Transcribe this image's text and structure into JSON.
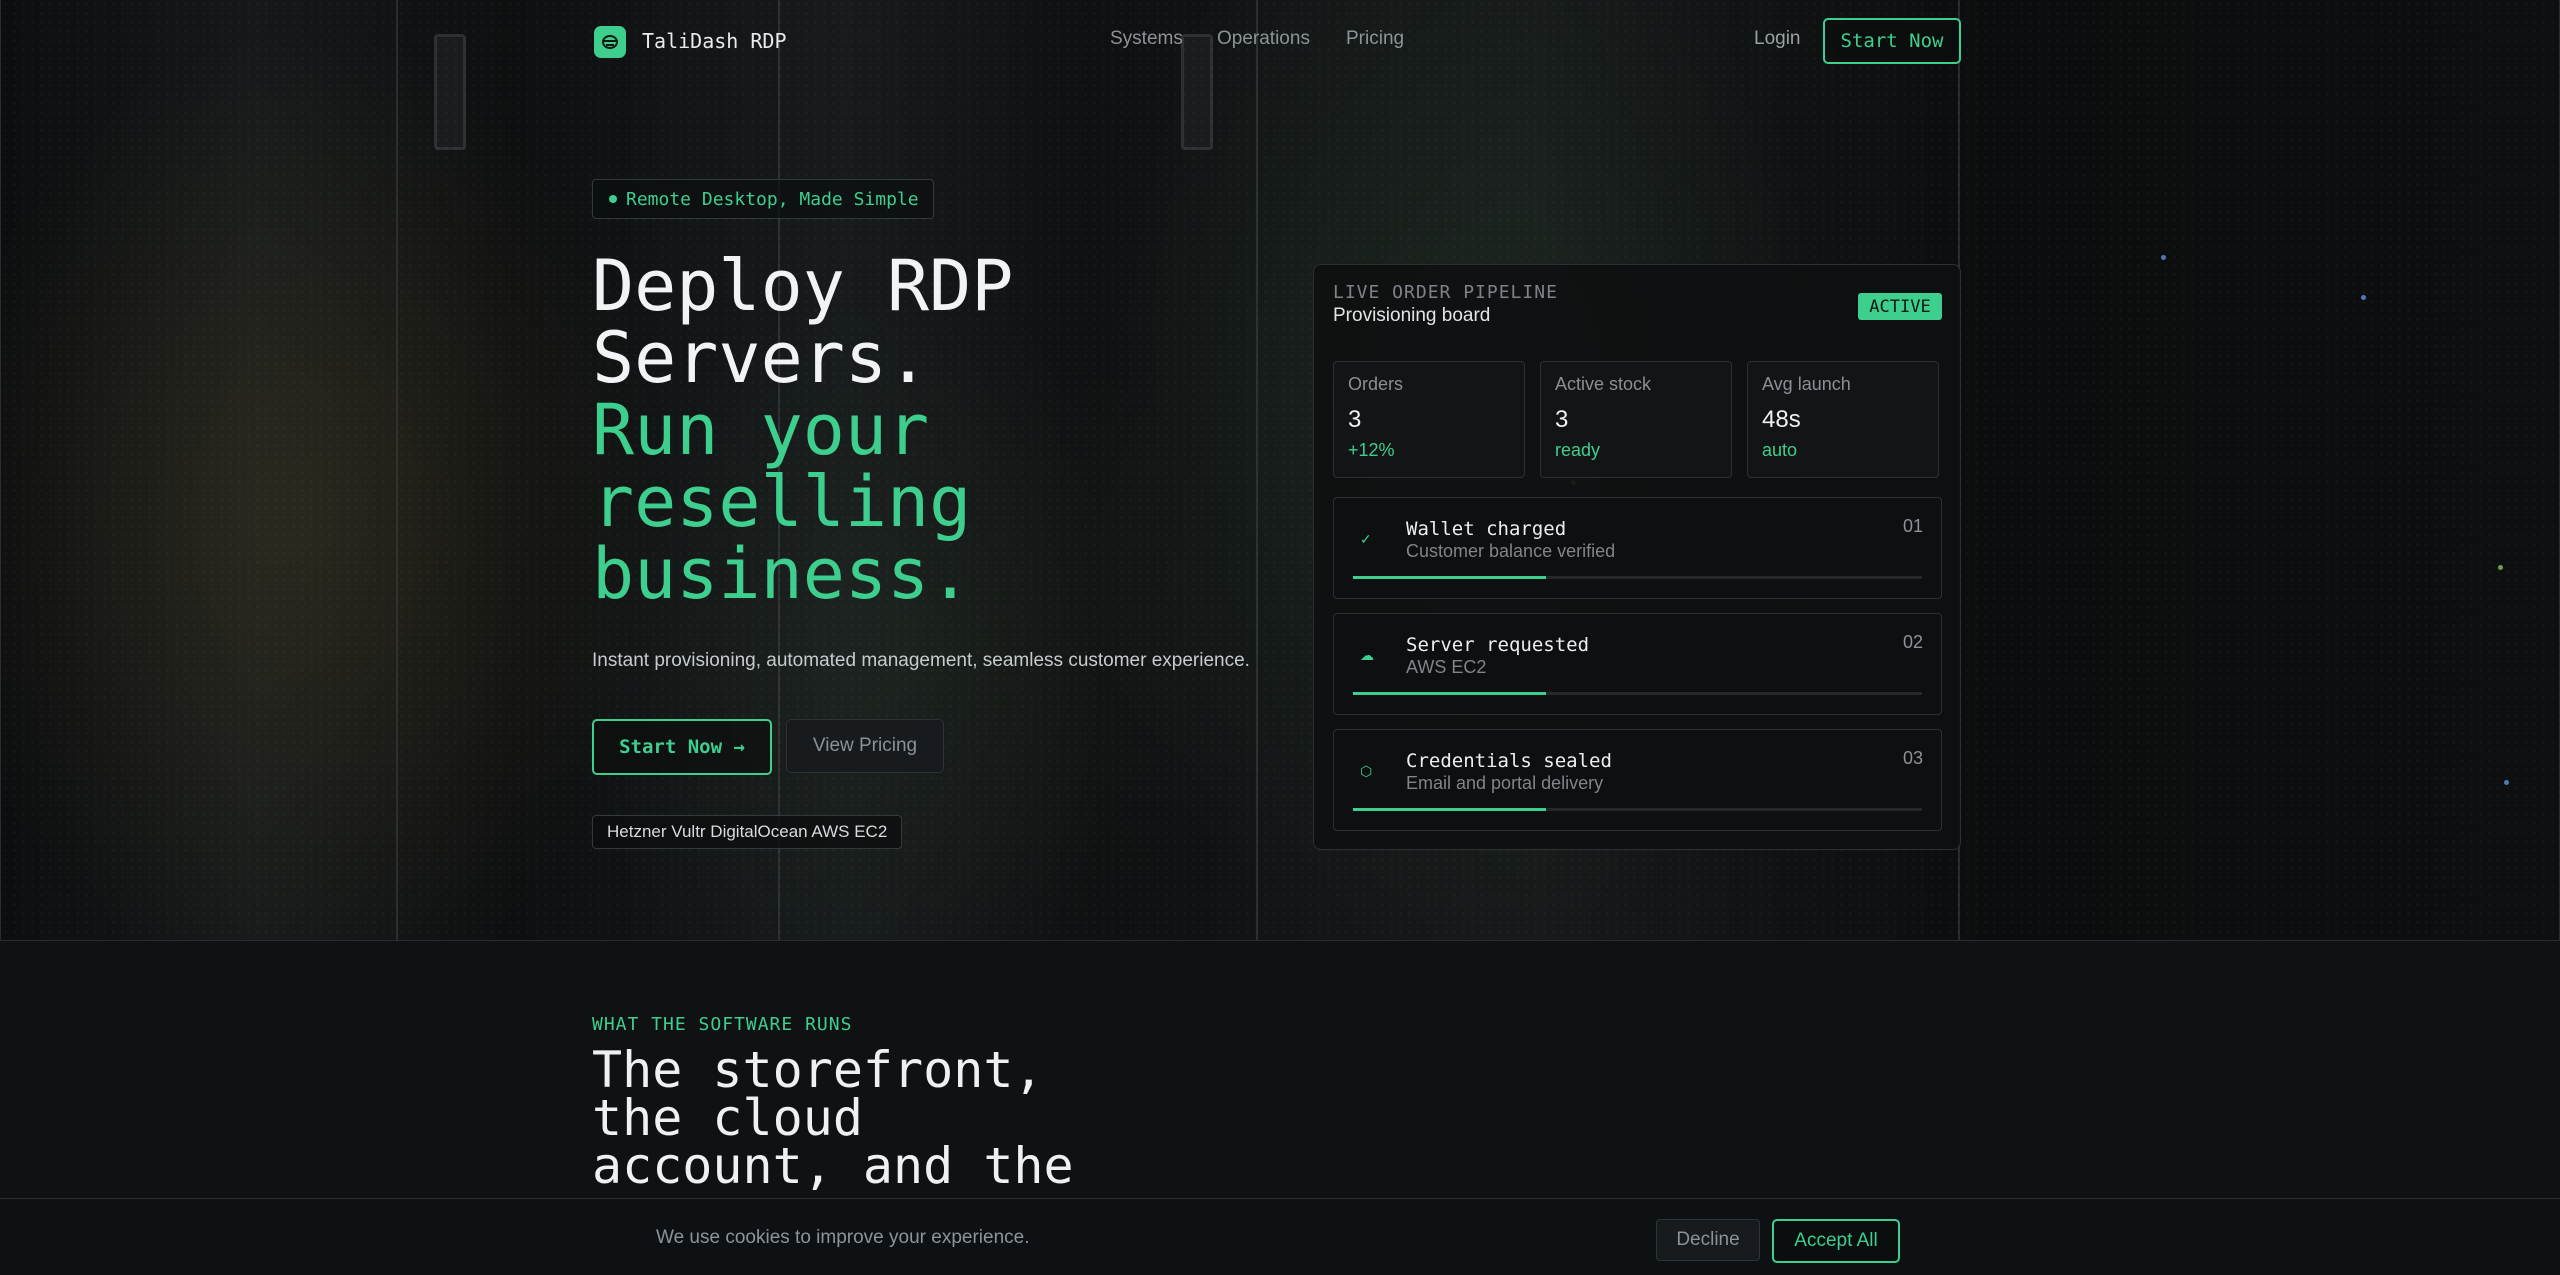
{
  "nav": {
    "brand": "TaliDash RDP",
    "links": [
      "Systems",
      "Operations",
      "Pricing"
    ],
    "login": "Login",
    "cta": "Start Now"
  },
  "hero": {
    "badge": "Remote Desktop, Made Simple",
    "headline_white": [
      "Deploy RDP",
      "Servers."
    ],
    "headline_green": [
      "Run your",
      "reselling",
      "business."
    ],
    "subtitle": "Instant provisioning, automated management, seamless customer experience.",
    "primary_cta": "Start Now →",
    "secondary_cta": "View Pricing",
    "providers": "Hetzner Vultr DigitalOcean AWS EC2"
  },
  "pipeline": {
    "label": "LIVE ORDER PIPELINE",
    "title": "Provisioning board",
    "status": "ACTIVE",
    "stats": [
      {
        "label": "Orders",
        "value": "3",
        "delta": "+12%"
      },
      {
        "label": "Active stock",
        "value": "3",
        "delta": "ready"
      },
      {
        "label": "Avg launch",
        "value": "48s",
        "delta": "auto"
      }
    ],
    "steps": [
      {
        "icon": "check-icon",
        "title": "Wallet charged",
        "desc": "Customer balance verified",
        "num": "01",
        "progress": 0.34
      },
      {
        "icon": "cloud-icon",
        "title": "Server requested",
        "desc": "AWS EC2",
        "num": "02",
        "progress": 0.34
      },
      {
        "icon": "hexagon-icon",
        "title": "Credentials sealed",
        "desc": "Email and portal delivery",
        "num": "03",
        "progress": 0.34
      }
    ]
  },
  "section": {
    "eyebrow": "WHAT THE SOFTWARE RUNS",
    "title_lines": [
      "The storefront,",
      "the cloud",
      "account, and the"
    ]
  },
  "cookie": {
    "message": "We use cookies to improve your experience.",
    "decline": "Decline",
    "accept": "Accept All"
  },
  "colors": {
    "accent": "#3ecf8e",
    "background": "#0f1113"
  }
}
